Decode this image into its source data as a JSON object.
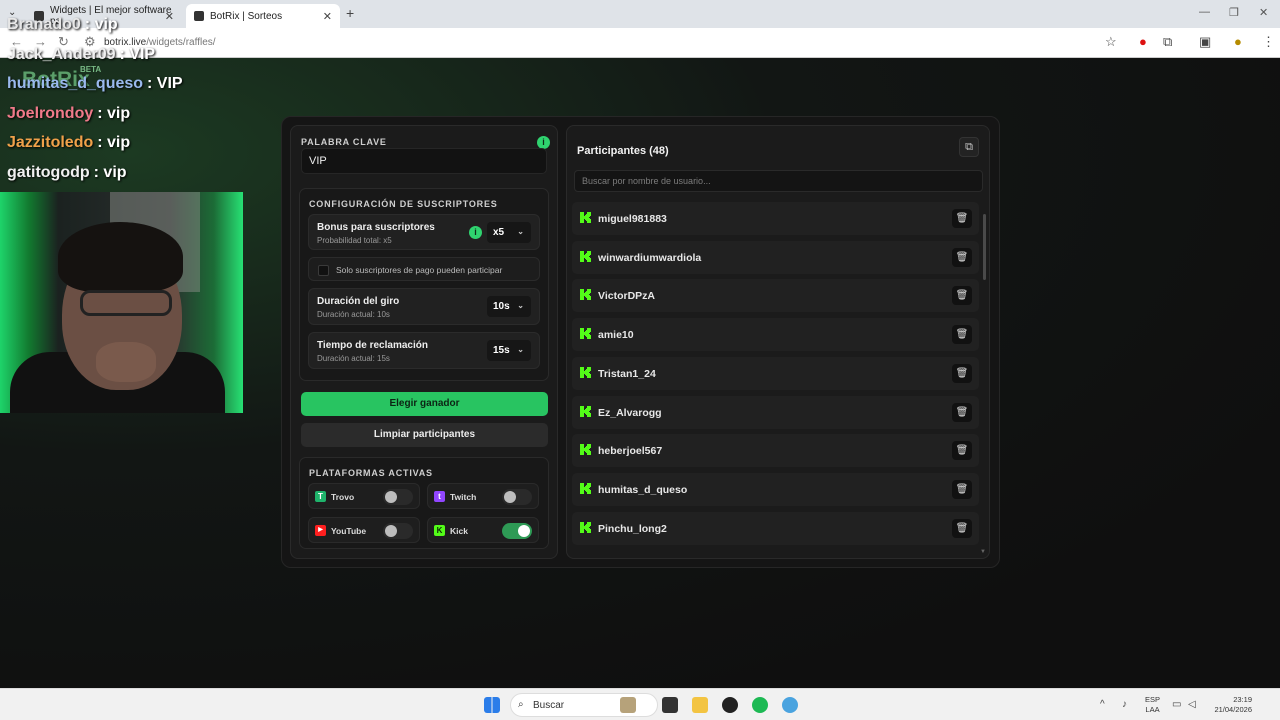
{
  "browser": {
    "tabs": [
      {
        "title": "Widgets | El mejor software pa",
        "active": false
      },
      {
        "title": "BotRix | Sorteos",
        "active": true
      }
    ],
    "url_host": "botrix.live",
    "url_path": "/widgets/raffles/"
  },
  "brand": {
    "logo": "BotRix",
    "badge": "BETA"
  },
  "stream_chat": [
    {
      "user": "Branado0",
      "message": ": vip",
      "color": "#e7e7e7"
    },
    {
      "user": "Jack_Ander09",
      "message": ": VIP",
      "color": "#f0f0f0"
    },
    {
      "user": "humitas_d_queso",
      "message": ": VIP",
      "color": "#9ab9ee"
    },
    {
      "user": "Joelrondoy",
      "message": ": vip",
      "color": "#f07a8a"
    },
    {
      "user": "Jazzitoledo",
      "message": ": vip",
      "color": "#f0a14a"
    },
    {
      "user": "gatitogodp",
      "message": ": vip",
      "color": "#f0f0f0"
    }
  ],
  "raffle": {
    "keyword_label": "PALABRA CLAVE",
    "keyword_value": "VIP",
    "subs_section_label": "CONFIGURACIÓN DE SUSCRIPTORES",
    "bonus": {
      "title": "Bonus para suscriptores",
      "subtitle": "Probabilidad total: x5",
      "value": "x5"
    },
    "paid_only_label": "Solo suscriptores de pago pueden participar",
    "paid_only_checked": false,
    "spin": {
      "title": "Duración del giro",
      "subtitle": "Duración actual: 10s",
      "value": "10s"
    },
    "claim": {
      "title": "Tiempo de reclamación",
      "subtitle": "Duración actual: 15s",
      "value": "15s"
    },
    "pick_winner_label": "Elegir ganador",
    "clear_label": "Limpiar participantes",
    "platforms_label": "PLATAFORMAS ACTIVAS",
    "platforms": [
      {
        "name": "Trovo",
        "enabled": false,
        "color": "#1fb36b"
      },
      {
        "name": "Twitch",
        "enabled": false,
        "color": "#9146ff"
      },
      {
        "name": "YouTube",
        "enabled": false,
        "color": "#ff1f1f"
      },
      {
        "name": "Kick",
        "enabled": true,
        "color": "#53fc18"
      }
    ]
  },
  "participants": {
    "title": "Participantes (48)",
    "search_placeholder": "Buscar por nombre de usuario...",
    "list": [
      "miguel981883",
      "winwardiumwardiola",
      "VictorDPzA",
      "amie10",
      "Tristan1_24",
      "Ez_Alvarogg",
      "heberjoel567",
      "humitas_d_queso",
      "Pinchu_long2"
    ]
  },
  "taskbar": {
    "search_label": "Buscar",
    "lang_line1": "ESP",
    "lang_line2": "LAA",
    "time": "23:19",
    "date": "21/04/2026"
  },
  "colors": {
    "accent": "#28c461",
    "kick": "#53fc18",
    "panel": "#1b1b1b"
  }
}
